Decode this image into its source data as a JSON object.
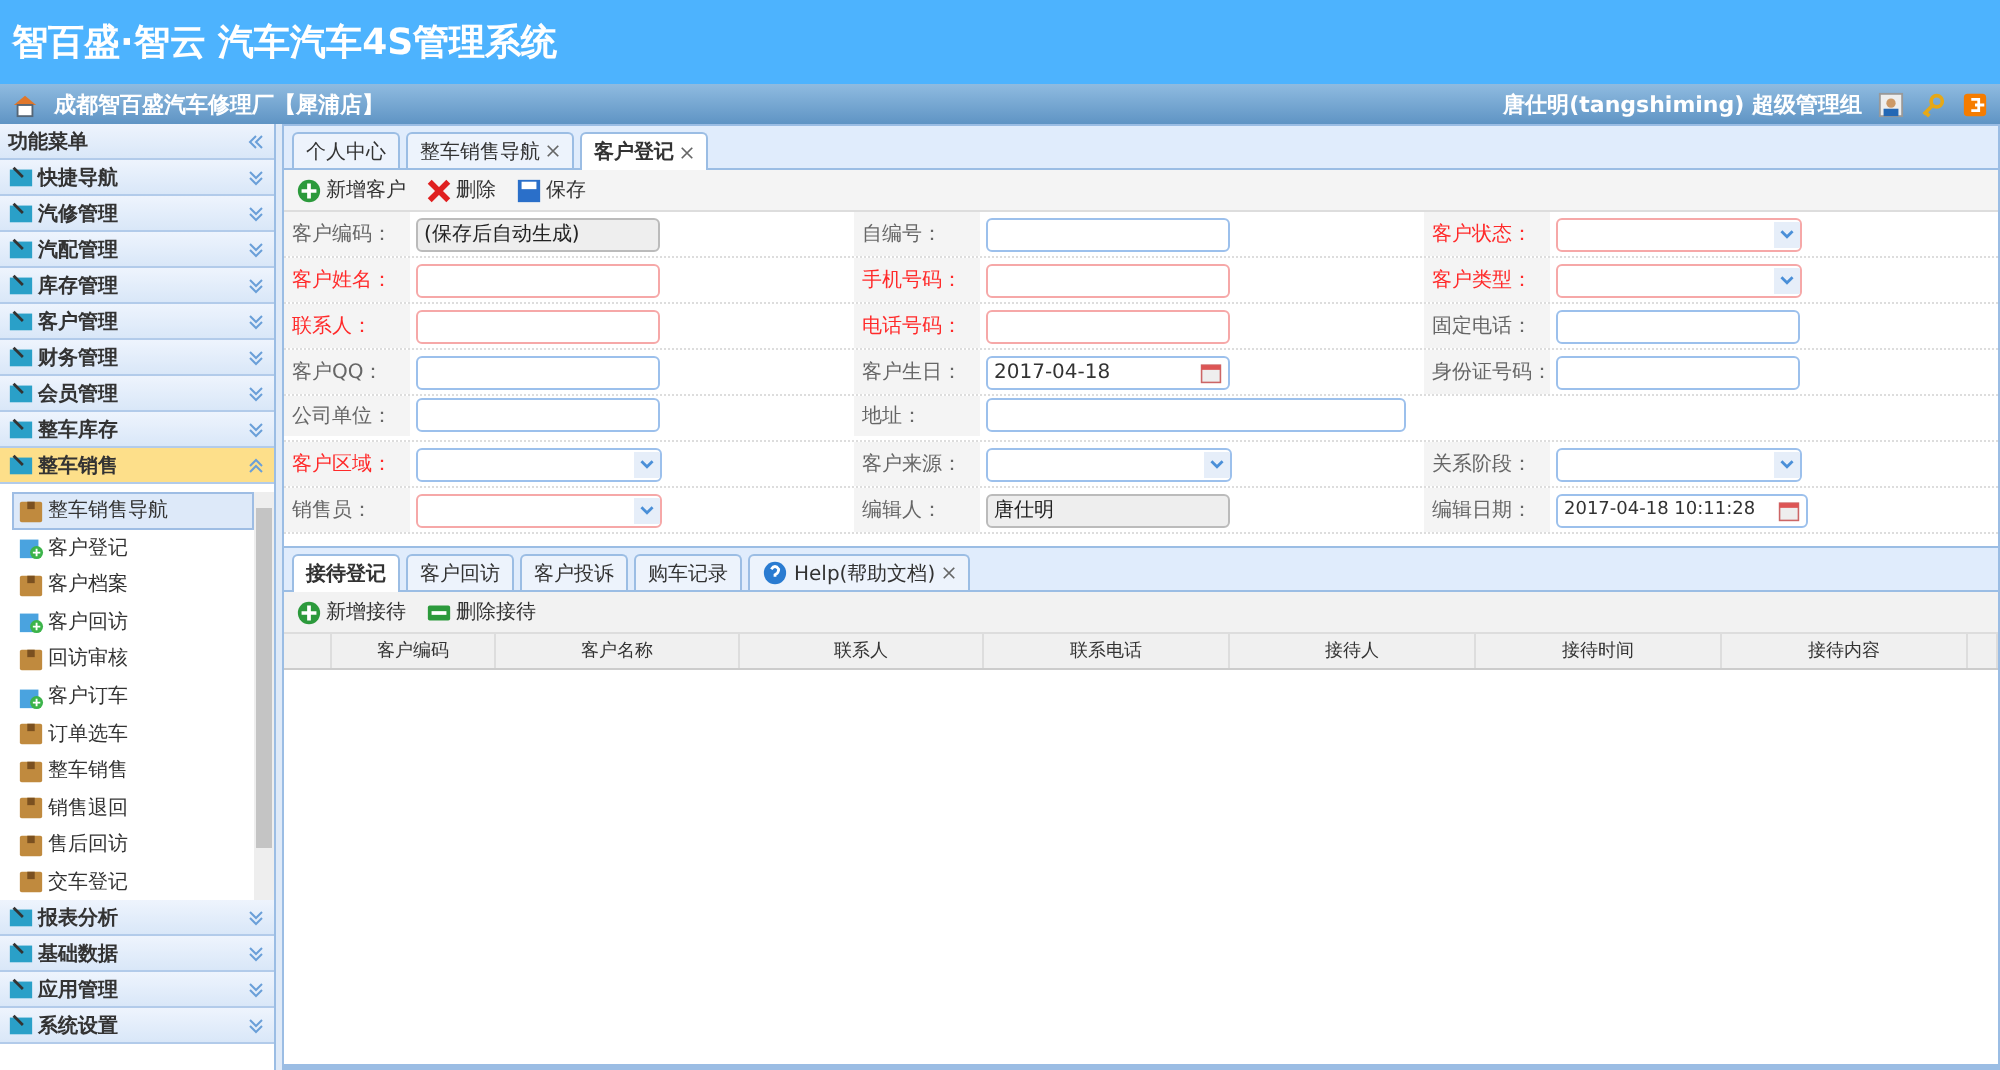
{
  "app_title": "智百盛·智云 汽车汽车4S管理系统",
  "branch": "成都智百盛汽车修理厂【犀浦店】",
  "user": "唐仕明(tangshiming) 超级管理组",
  "sidebar": {
    "title": "功能菜单",
    "sections": [
      {
        "label": "快捷导航",
        "expanded": false
      },
      {
        "label": "汽修管理",
        "expanded": false
      },
      {
        "label": "汽配管理",
        "expanded": false
      },
      {
        "label": "库存管理",
        "expanded": false
      },
      {
        "label": "客户管理",
        "expanded": false
      },
      {
        "label": "财务管理",
        "expanded": false
      },
      {
        "label": "会员管理",
        "expanded": false
      },
      {
        "label": "整车库存",
        "expanded": false
      },
      {
        "label": "整车销售",
        "expanded": true,
        "items": [
          {
            "label": "整车销售导航",
            "kind": "bag",
            "selected": true
          },
          {
            "label": "客户登记",
            "kind": "add",
            "selected": false
          },
          {
            "label": "客户档案",
            "kind": "bag",
            "selected": false
          },
          {
            "label": "客户回访",
            "kind": "add",
            "selected": false
          },
          {
            "label": "回访审核",
            "kind": "bag",
            "selected": false
          },
          {
            "label": "客户订车",
            "kind": "add",
            "selected": false
          },
          {
            "label": "订单选车",
            "kind": "bag",
            "selected": false
          },
          {
            "label": "整车销售",
            "kind": "bag",
            "selected": false
          },
          {
            "label": "销售退回",
            "kind": "bag",
            "selected": false
          },
          {
            "label": "售后回访",
            "kind": "bag",
            "selected": false
          },
          {
            "label": "交车登记",
            "kind": "bag",
            "selected": false
          }
        ]
      },
      {
        "label": "报表分析",
        "expanded": false
      },
      {
        "label": "基础数据",
        "expanded": false
      },
      {
        "label": "应用管理",
        "expanded": false
      },
      {
        "label": "系统设置",
        "expanded": false
      }
    ]
  },
  "tabs": [
    {
      "label": "个人中心",
      "closable": false,
      "selected": false
    },
    {
      "label": "整车销售导航",
      "closable": true,
      "selected": false
    },
    {
      "label": "客户登记",
      "closable": true,
      "selected": true
    }
  ],
  "toolbar": [
    "新增客户",
    "删除",
    "保存"
  ],
  "form_rows": [
    [
      {
        "label": "客户编码：",
        "required": false,
        "kind": "readonly",
        "value": "(保存后自动生成)"
      },
      {
        "label": "自编号：",
        "required": false,
        "invalid": false,
        "kind": "text"
      },
      {
        "label": "客户状态：",
        "required": true,
        "invalid": true,
        "kind": "select"
      }
    ],
    [
      {
        "label": "客户姓名：",
        "required": true,
        "invalid": true,
        "kind": "text"
      },
      {
        "label": "手机号码：",
        "required": true,
        "invalid": true,
        "kind": "text"
      },
      {
        "label": "客户类型：",
        "required": true,
        "invalid": true,
        "kind": "select"
      }
    ],
    [
      {
        "label": "联系人：",
        "required": true,
        "invalid": true,
        "kind": "text"
      },
      {
        "label": "电话号码：",
        "required": true,
        "invalid": true,
        "kind": "text"
      },
      {
        "label": "固定电话：",
        "required": false,
        "invalid": false,
        "kind": "text"
      }
    ],
    [
      {
        "label": "客户QQ：",
        "required": false,
        "invalid": false,
        "kind": "text"
      },
      {
        "label": "客户生日：",
        "required": false,
        "invalid": false,
        "kind": "date",
        "value": "2017-04-18"
      },
      {
        "label": "身份证号码：",
        "required": false,
        "invalid": false,
        "kind": "text"
      }
    ],
    [
      {
        "label": "公司单位：",
        "required": false,
        "invalid": false,
        "kind": "text"
      },
      {
        "label": "地址：",
        "required": false,
        "invalid": false,
        "kind": "wide"
      }
    ],
    [
      {
        "label": "客户区域：",
        "required": true,
        "invalid": false,
        "kind": "select"
      },
      {
        "label": "客户来源：",
        "required": false,
        "invalid": false,
        "kind": "select"
      },
      {
        "label": "关系阶段：",
        "required": false,
        "invalid": false,
        "kind": "select"
      }
    ],
    [
      {
        "label": "销售员：",
        "required": false,
        "invalid": true,
        "kind": "select"
      },
      {
        "label": "编辑人：",
        "required": false,
        "kind": "readonly",
        "value": "唐仕明"
      },
      {
        "label": "编辑日期：",
        "required": false,
        "invalid": false,
        "kind": "date",
        "value": "2017-04-18 10:11:28"
      }
    ]
  ],
  "sub_tabs": [
    {
      "label": "接待登记",
      "closable": false,
      "selected": true
    },
    {
      "label": "客户回访",
      "closable": false,
      "selected": false
    },
    {
      "label": "客户投诉",
      "closable": false,
      "selected": false
    },
    {
      "label": "购车记录",
      "closable": false,
      "selected": false
    },
    {
      "label": "Help(帮助文档)",
      "closable": true,
      "selected": false
    }
  ],
  "sub_toolbar": [
    "新增接待",
    "删除接待"
  ],
  "table": {
    "columns": [
      "客户编码",
      "客户名称",
      "联系人",
      "联系电话",
      "接待人",
      "接待时间",
      "接待内容"
    ]
  }
}
